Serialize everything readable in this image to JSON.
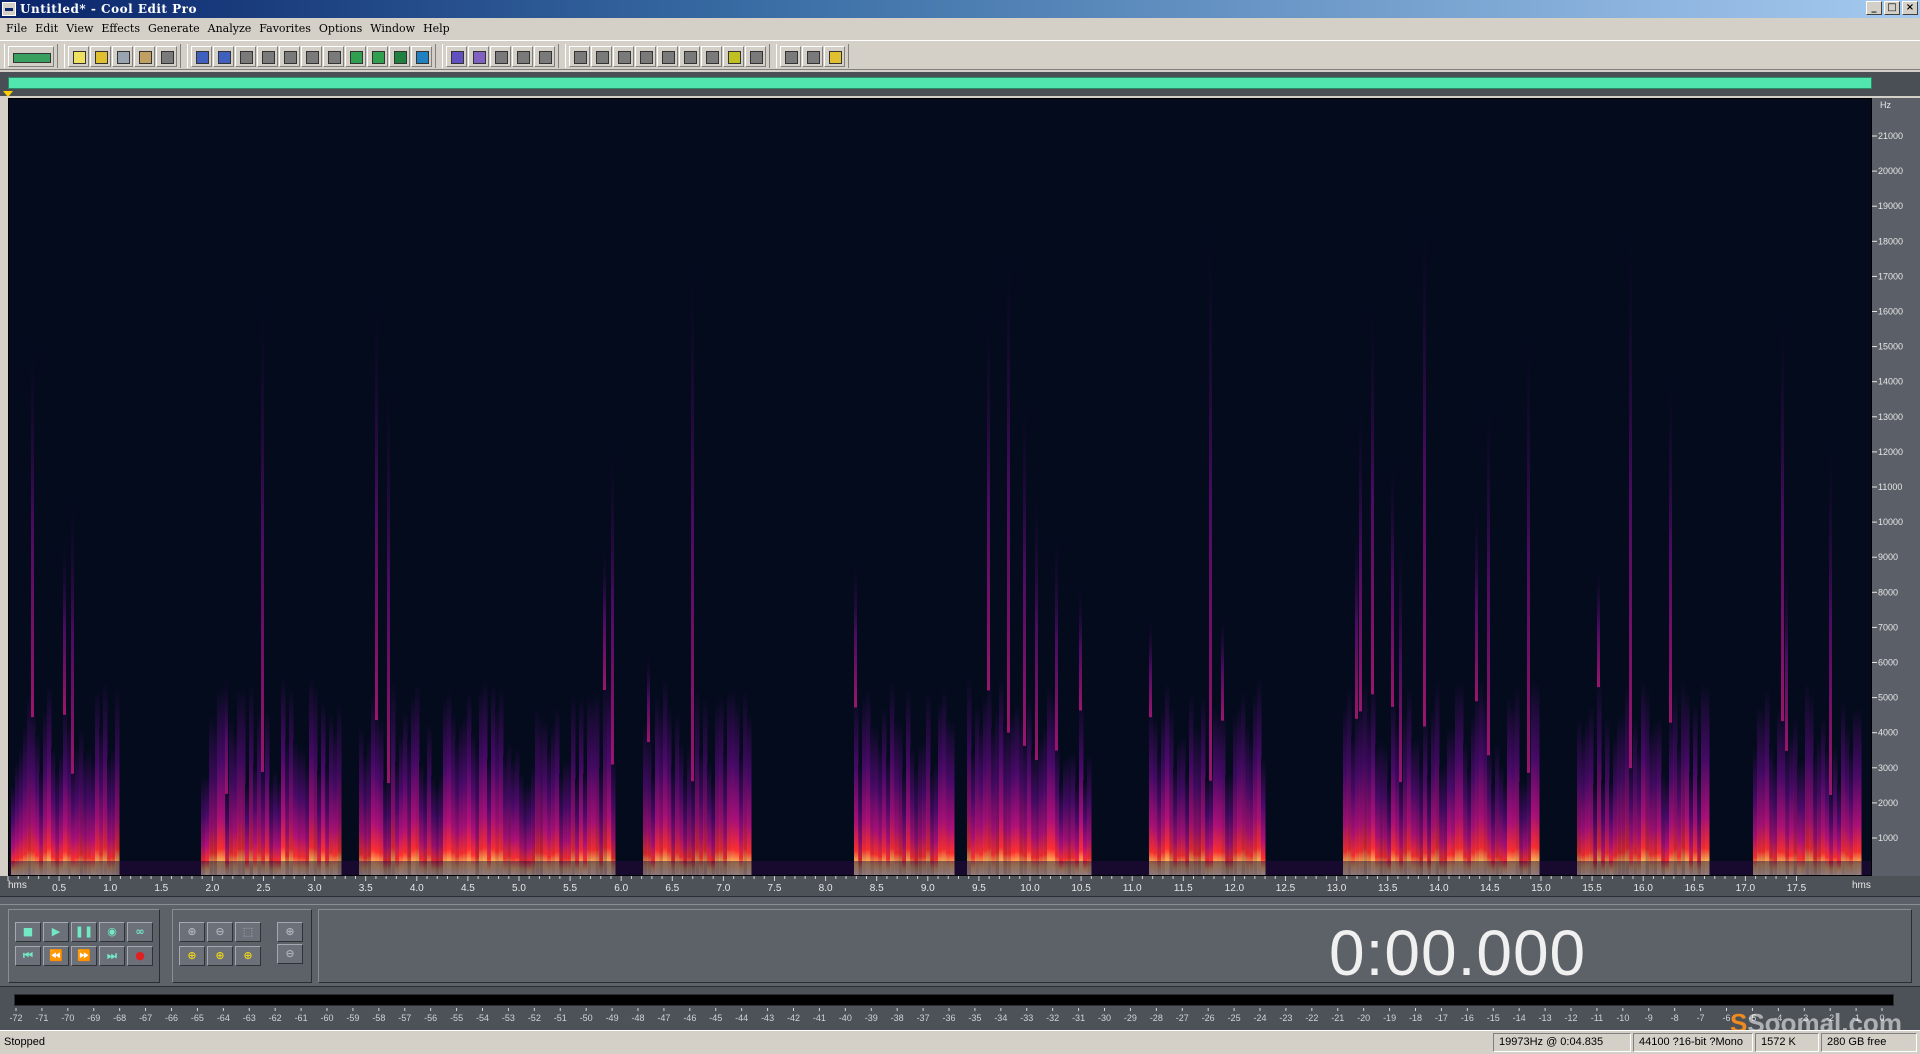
{
  "window": {
    "title": "Untitled* - Cool Edit Pro",
    "buttons": [
      "_",
      "□",
      "×"
    ]
  },
  "menu": [
    "File",
    "Edit",
    "View",
    "Effects",
    "Generate",
    "Analyze",
    "Favorites",
    "Options",
    "Window",
    "Help"
  ],
  "toolbar": {
    "groups": [
      [
        "multitrack-toggle-icon"
      ],
      [
        "new-file-icon",
        "open-file-icon",
        "save-icon",
        "save-as-icon",
        "close-file-icon"
      ],
      [
        "undo-icon",
        "redo-icon",
        "repeat-icon",
        "copy-icon",
        "paste-icon",
        "cut-icon",
        "trim-icon",
        "paste-new-icon",
        "mix-paste-icon",
        "insert-icon",
        "crossfade-icon"
      ],
      [
        "envelope-icon",
        "fade-icon",
        "normalize-icon",
        "dynamics-icon",
        "filter-icon"
      ],
      [
        "waveform-view-icon",
        "spectral-view-icon",
        "cue-list-icon",
        "play-list-icon",
        "info-icon",
        "time-format-icon",
        "frequency-analysis-icon",
        "level-meter-icon",
        "status-bar-icon"
      ],
      [
        "cd-player-icon",
        "tools-icon",
        "help-icon"
      ]
    ],
    "colors": {
      "new-file-icon": "#f0e060",
      "open-file-icon": "#e0c030",
      "save-icon": "#9aa4b0",
      "save-as-icon": "#c0a060",
      "undo-icon": "#4060c0",
      "redo-icon": "#4060c0",
      "paste-new-icon": "#30a050",
      "mix-paste-icon": "#30a050",
      "insert-icon": "#208040",
      "crossfade-icon": "#2080c0",
      "envelope-icon": "#6050c0",
      "fade-icon": "#8060c0",
      "level-meter-icon": "#c0c020",
      "help-icon": "#e0c030"
    }
  },
  "spectral": {
    "frequency_unit": "Hz",
    "frequency_ticks": [
      "21000",
      "20000",
      "19000",
      "18000",
      "17000",
      "16000",
      "15000",
      "14000",
      "13000",
      "12000",
      "11000",
      "10000",
      "9000",
      "8000",
      "7000",
      "6000",
      "5000",
      "4000",
      "3000",
      "2000",
      "1000"
    ],
    "time_unit": "hms",
    "time_ticks": [
      "0.5",
      "1.0",
      "1.5",
      "2.0",
      "2.5",
      "3.0",
      "3.5",
      "4.0",
      "4.5",
      "5.0",
      "5.5",
      "6.0",
      "6.5",
      "7.0",
      "7.5",
      "8.0",
      "8.5",
      "9.0",
      "9.5",
      "10.0",
      "10.5",
      "11.0",
      "11.5",
      "12.0",
      "12.5",
      "13.0",
      "13.5",
      "14.0",
      "14.5",
      "15.0",
      "15.5",
      "16.0",
      "16.5",
      "17.0",
      "17.5"
    ]
  },
  "transport": {
    "row1": [
      "■",
      "▶",
      "❚❚",
      "◉",
      "∞"
    ],
    "row1_names": [
      "stop-icon",
      "play-icon",
      "pause-icon",
      "play-to-end-icon",
      "loop-icon"
    ],
    "row2": [
      "⏮",
      "⏪",
      "⏩",
      "⏭",
      "●"
    ],
    "row2_names": [
      "go-to-start-icon",
      "rewind-icon",
      "fast-forward-icon",
      "go-to-end-icon",
      "record-icon"
    ],
    "zoom_row1": [
      "⊕",
      "⊖",
      "⬚"
    ],
    "zoom_row1_names": [
      "zoom-in-icon",
      "zoom-out-icon",
      "zoom-full-icon"
    ],
    "zoom_row2": [
      "⊕",
      "⊕",
      "⊕"
    ],
    "zoom_row2_names": [
      "zoom-left-icon",
      "zoom-right-icon",
      "zoom-selection-icon"
    ],
    "vzoom": [
      "⊕",
      "⊖"
    ],
    "vzoom_names": [
      "vertical-zoom-in-icon",
      "vertical-zoom-out-icon"
    ],
    "time_display": "0:00.000"
  },
  "level_meter": {
    "ticks": [
      "-72",
      "-71",
      "-70",
      "-69",
      "-68",
      "-67",
      "-66",
      "-65",
      "-64",
      "-63",
      "-62",
      "-61",
      "-60",
      "-59",
      "-58",
      "-57",
      "-56",
      "-55",
      "-54",
      "-53",
      "-52",
      "-51",
      "-50",
      "-49",
      "-48",
      "-47",
      "-46",
      "-45",
      "-44",
      "-43",
      "-42",
      "-41",
      "-40",
      "-39",
      "-38",
      "-37",
      "-36",
      "-35",
      "-34",
      "-33",
      "-32",
      "-31",
      "-30",
      "-29",
      "-28",
      "-27",
      "-26",
      "-25",
      "-24",
      "-23",
      "-22",
      "-21",
      "-20",
      "-19",
      "-18",
      "-17",
      "-16",
      "-15",
      "-14",
      "-13",
      "-12",
      "-11",
      "-10",
      "-9",
      "-8",
      "-7",
      "-6",
      "-5",
      "-4",
      "-3",
      "-2",
      "-1",
      "0"
    ]
  },
  "watermark": {
    "mark": "S",
    "text": "Soomal.com"
  },
  "status": {
    "state": "Stopped",
    "cursor": "19973Hz @   0:04.835",
    "format": "44100 ?16-bit ?Mono",
    "size": "1572 K",
    "free": "280 GB free"
  },
  "colors": {
    "progress": "#50e6ad",
    "spectral_background": "#040b1d",
    "panel": "#5d6168",
    "transport_icons": "#72e8c4",
    "record": "#e02020"
  }
}
